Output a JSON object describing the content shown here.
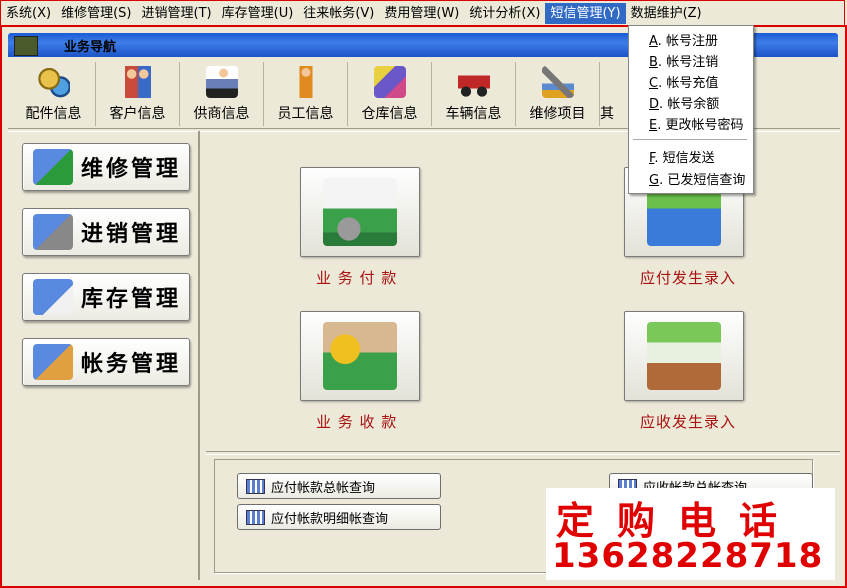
{
  "menubar": {
    "items": [
      {
        "label": "系统",
        "hotkey": "(X)"
      },
      {
        "label": "维修管理",
        "hotkey": "(S)"
      },
      {
        "label": "进销管理",
        "hotkey": "(T)"
      },
      {
        "label": "库存管理",
        "hotkey": "(U)"
      },
      {
        "label": "往来帐务",
        "hotkey": "(V)"
      },
      {
        "label": "费用管理",
        "hotkey": "(W)"
      },
      {
        "label": "统计分析",
        "hotkey": "(X)"
      },
      {
        "label": "短信管理",
        "hotkey": "(Y)"
      },
      {
        "label": "数据维护",
        "hotkey": "(Z)"
      }
    ]
  },
  "dropdown": {
    "items": [
      {
        "key": "A",
        "label": "帐号注册"
      },
      {
        "key": "B",
        "label": "帐号注销"
      },
      {
        "key": "C",
        "label": "帐号充值"
      },
      {
        "key": "D",
        "label": "帐号余额"
      },
      {
        "key": "E",
        "label": "更改帐号密码"
      },
      {
        "key": "F",
        "label": "短信发送"
      },
      {
        "key": "G",
        "label": "已发短信查询"
      }
    ]
  },
  "window": {
    "title": "业务导航"
  },
  "toolbar": {
    "items": [
      {
        "label": "配件信息",
        "icon": "gears-icon",
        "color": "#c8a032"
      },
      {
        "label": "客户信息",
        "icon": "people-icon",
        "color": "#d0603a"
      },
      {
        "label": "供商信息",
        "icon": "supplier-icon",
        "color": "#6a7fb8"
      },
      {
        "label": "员工信息",
        "icon": "worker-icon",
        "color": "#e08a20"
      },
      {
        "label": "仓库信息",
        "icon": "warehouse-blocks-icon",
        "color": "#6a58c8"
      },
      {
        "label": "车辆信息",
        "icon": "race-car-icon",
        "color": "#c02828"
      },
      {
        "label": "维修项目",
        "icon": "tools-icon",
        "color": "#5a8ad0"
      },
      {
        "label": "其",
        "icon": "other-icon",
        "color": "#888888"
      }
    ]
  },
  "nav": {
    "items": [
      {
        "label": "维修管理",
        "icon": "repair-icon"
      },
      {
        "label": "进销管理",
        "icon": "purchase-sales-icon"
      },
      {
        "label": "库存管理",
        "icon": "inventory-icon"
      },
      {
        "label": "帐务管理",
        "icon": "accounting-icon"
      }
    ]
  },
  "tiles": {
    "pay": {
      "label": "业 务 付 款",
      "icon": "business-payment-icon"
    },
    "payable": {
      "label": "应付发生录入",
      "icon": "payable-entry-icon"
    },
    "receive": {
      "label": "业 务 收 款",
      "icon": "business-receipt-icon"
    },
    "receivable": {
      "label": "应收发生录入",
      "icon": "receivable-entry-icon"
    }
  },
  "queries": {
    "payable_total": "应付帐款总帐查询",
    "payable_detail": "应付帐款明细帐查询",
    "receivable_total": "应收帐款总帐查询"
  },
  "ad": {
    "title": "定购电话",
    "phone": "13628228718"
  }
}
